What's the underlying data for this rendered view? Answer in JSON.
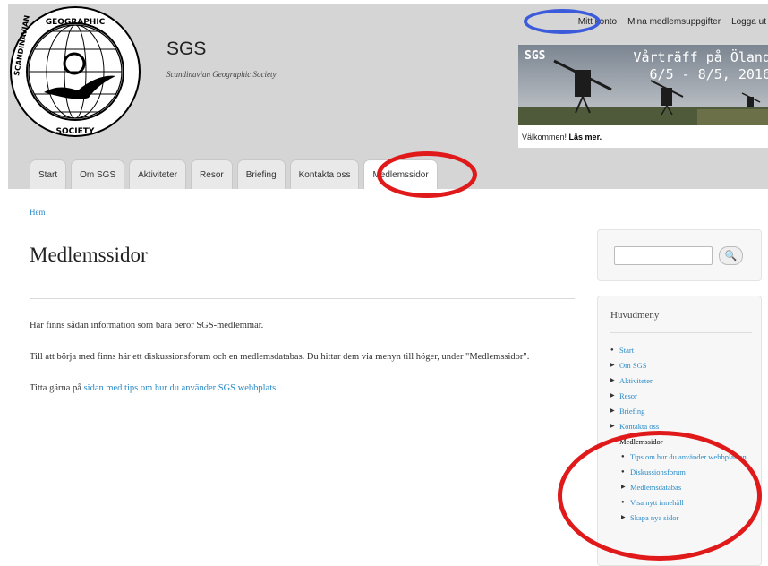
{
  "header": {
    "site_name": "SGS",
    "slogan": "Scandinavian Geographic Society",
    "logo": {
      "icon": "globe-bird-logo",
      "ring_text": "SCANDINAVIAN GEOGRAPHIC SOCIETY"
    }
  },
  "secondary_menu": {
    "my_account": "Mitt konto",
    "member_info": "Mina medlemsuppgifter",
    "logout": "Logga ut"
  },
  "banner": {
    "brand": "SGS",
    "title_line1": "Vårträff på Öland",
    "title_line2": "6/5 - 8/5, 2016",
    "caption_prefix": "Välkommen!",
    "caption_link": "Läs mer."
  },
  "tabs": [
    {
      "label": "Start"
    },
    {
      "label": "Om SGS"
    },
    {
      "label": "Aktiviteter"
    },
    {
      "label": "Resor"
    },
    {
      "label": "Briefing"
    },
    {
      "label": "Kontakta oss"
    },
    {
      "label": "Medlemssidor"
    }
  ],
  "breadcrumb": "Hem",
  "page": {
    "title": "Medlemssidor",
    "p1": "Här finns sådan information som bara berör SGS-medlemmar.",
    "p2": "Till att börja med finns här ett diskussionsforum och en medlemsdatabas.  Du hittar dem via menyn till höger, under \"Medlemssidor\".",
    "p3_prefix": "Titta gärna på ",
    "p3_link": "sidan med tips om hur du använder SGS webbplats",
    "p3_suffix": "."
  },
  "search": {
    "button_icon": "search-icon",
    "button_glyph": "🔍"
  },
  "main_menu": {
    "title": "Huvudmeny",
    "items": [
      {
        "label": "Start"
      },
      {
        "label": "Om SGS"
      },
      {
        "label": "Aktiviteter"
      },
      {
        "label": "Resor"
      },
      {
        "label": "Briefing"
      },
      {
        "label": "Kontakta oss"
      },
      {
        "label": "Medlemssidor"
      }
    ],
    "subitems": [
      {
        "label": "Tips om hur du använder webbplatsen"
      },
      {
        "label": "Diskussionsforum"
      },
      {
        "label": "Medlemsdatabas"
      },
      {
        "label": "Visa nytt innehåll"
      },
      {
        "label": "Skapa nya sidor"
      }
    ]
  },
  "colors": {
    "header_bg": "#d5d5d5",
    "link": "#2a8bc9",
    "highlight_red": "#e01a1a",
    "highlight_blue": "#3b5bdb"
  }
}
